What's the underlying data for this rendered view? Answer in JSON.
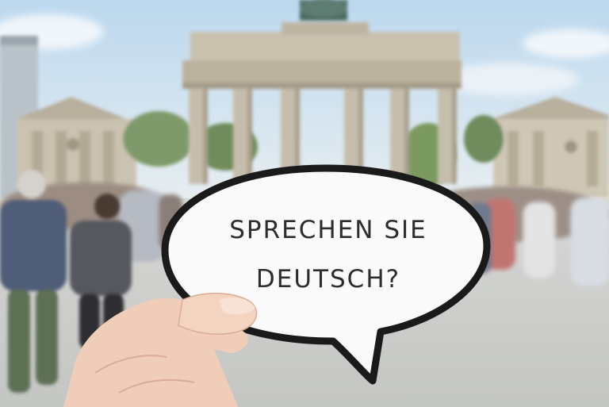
{
  "photo": {
    "subject": "hand holding speech bubble in front of Brandenburg Gate",
    "colors": {
      "sky": "#cfe3f2",
      "gate_stone": "#cfc8b8",
      "gate_shadow": "#a89f8e",
      "ground": "#cfd1cf",
      "bubble_fill": "#fafafa",
      "bubble_outline": "#1a1a1a",
      "skin": "#f2d2bf"
    }
  },
  "speech_bubble": {
    "line1": "SPRECHEN SIE",
    "line2": "DEUTSCH?"
  }
}
